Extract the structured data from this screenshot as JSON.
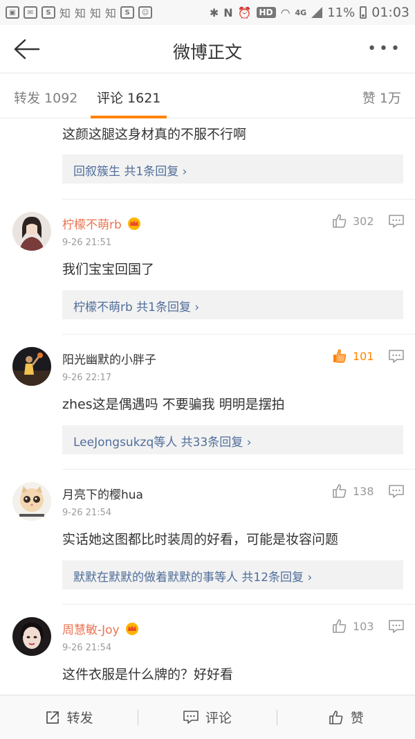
{
  "status_bar": {
    "icons": [
      "image-icon",
      "mail-icon",
      "s-icon"
    ],
    "apps": [
      "知",
      "知",
      "知",
      "知"
    ],
    "hd": "HD",
    "network": "4G",
    "battery": "11%",
    "time": "01:03"
  },
  "header": {
    "title": "微博正文",
    "more": "•••"
  },
  "tabs": {
    "forward": "转发 1092",
    "comment": "评论 1621",
    "like": "赞 1万"
  },
  "colors": {
    "accent": "#ff8200",
    "name_vip": "#eb7350",
    "link": "#506e9a"
  },
  "comments": [
    {
      "text": "这颜这腿这身材真的不服不行啊",
      "reply": "回叙簇生  共1条回复 ›"
    },
    {
      "name": "柠檬不萌rb",
      "time": "9-26 21:51",
      "likes": "302",
      "text": "我们宝宝回国了",
      "reply": "柠檬不萌rb  共1条回复 ›"
    },
    {
      "name": "阳光幽默的小胖子",
      "time": "9-26 22:17",
      "likes": "101",
      "text": "zhes这是偶遇吗  不要骗我   明明是摆拍",
      "reply": "LeeJongsukzq等人  共33条回复 ›"
    },
    {
      "name": "月亮下的樱hua",
      "time": "9-26 21:54",
      "likes": "138",
      "text": "实话她这图都比时装周的好看，可能是妆容问题",
      "reply": "默默在默默的做着默默的事等人  共12条回复 ›"
    },
    {
      "name": "周慧敏-Joy",
      "time": "9-26 21:54",
      "likes": "103",
      "text": "这件衣服是什么牌的？好好看"
    }
  ],
  "bottom_bar": {
    "forward": "转发",
    "comment": "评论",
    "like": "赞"
  }
}
